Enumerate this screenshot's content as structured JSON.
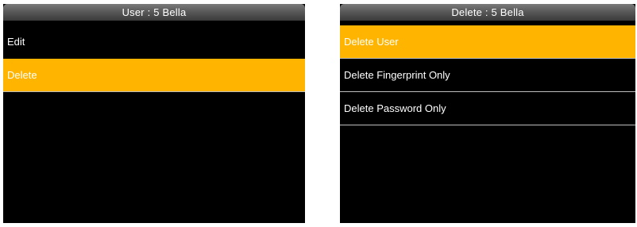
{
  "colors": {
    "screen_background": "#000000",
    "highlight": "#ffb400",
    "text": "#ffffff",
    "separator": "#bdbdbd"
  },
  "left_screen": {
    "title": "User : 5 Bella",
    "items": [
      {
        "label": "Edit",
        "selected": false
      },
      {
        "label": "Delete",
        "selected": true
      }
    ]
  },
  "right_screen": {
    "title": "Delete : 5 Bella",
    "items": [
      {
        "label": "Delete User",
        "selected": true
      },
      {
        "label": "Delete Fingerprint Only",
        "selected": false
      },
      {
        "label": "Delete Password Only",
        "selected": false
      }
    ]
  }
}
